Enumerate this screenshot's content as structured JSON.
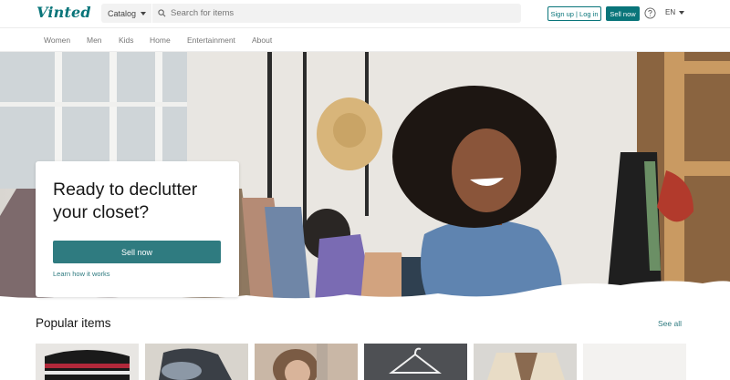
{
  "header": {
    "logo": "Vinted",
    "catalog_label": "Catalog",
    "search_placeholder": "Search for items",
    "signup_label": "Sign up | Log in",
    "sell_label": "Sell now",
    "language": "EN"
  },
  "nav": {
    "items": [
      "Women",
      "Men",
      "Kids",
      "Home",
      "Entertainment",
      "About"
    ]
  },
  "hero": {
    "title": "Ready to declutter your closet?",
    "sell_label": "Sell now",
    "learn_label": "Learn how it works"
  },
  "popular": {
    "title": "Popular items",
    "see_all": "See all"
  },
  "colors": {
    "brand": "#09757a",
    "button": "#2f7b80"
  }
}
